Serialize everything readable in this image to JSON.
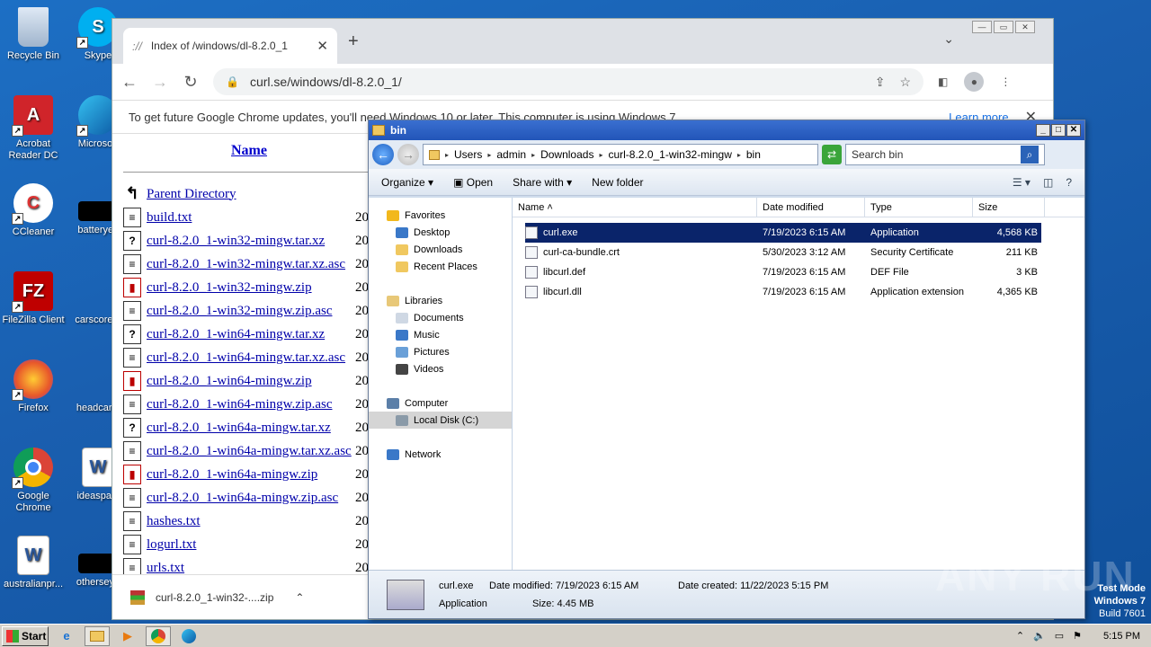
{
  "desktop": {
    "icons_col1": [
      "Recycle Bin",
      "Acrobat Reader DC",
      "CCleaner",
      "FileZilla Client",
      "Firefox",
      "Google Chrome",
      "australianpr..."
    ],
    "icons_col2": [
      "Skype",
      "Microsoft",
      "batteryey",
      "carscore...",
      "headcar...",
      "ideaspain",
      "otherseyo"
    ]
  },
  "chrome": {
    "tab_title": "Index of /windows/dl-8.2.0_1",
    "url": "curl.se/windows/dl-8.2.0_1/",
    "infobar_text": "To get future Google Chrome updates, you'll need Windows 10 or later. This computer is using Windows 7.",
    "infobar_link": "Learn more",
    "column_name": "Name",
    "files": [
      {
        "name": "Parent Directory",
        "icon": "back"
      },
      {
        "name": "build.txt",
        "icon": "text"
      },
      {
        "name": "curl-8.2.0_1-win32-mingw.tar.xz",
        "icon": "unknown"
      },
      {
        "name": "curl-8.2.0_1-win32-mingw.tar.xz.asc",
        "icon": "text"
      },
      {
        "name": "curl-8.2.0_1-win32-mingw.zip",
        "icon": "zip"
      },
      {
        "name": "curl-8.2.0_1-win32-mingw.zip.asc",
        "icon": "text"
      },
      {
        "name": "curl-8.2.0_1-win64-mingw.tar.xz",
        "icon": "unknown"
      },
      {
        "name": "curl-8.2.0_1-win64-mingw.tar.xz.asc",
        "icon": "text"
      },
      {
        "name": "curl-8.2.0_1-win64-mingw.zip",
        "icon": "zip"
      },
      {
        "name": "curl-8.2.0_1-win64-mingw.zip.asc",
        "icon": "text"
      },
      {
        "name": "curl-8.2.0_1-win64a-mingw.tar.xz",
        "icon": "unknown"
      },
      {
        "name": "curl-8.2.0_1-win64a-mingw.tar.xz.asc",
        "icon": "text"
      },
      {
        "name": "curl-8.2.0_1-win64a-mingw.zip",
        "icon": "zip"
      },
      {
        "name": "curl-8.2.0_1-win64a-mingw.zip.asc",
        "icon": "text"
      },
      {
        "name": "hashes.txt",
        "icon": "text"
      },
      {
        "name": "logurl.txt",
        "icon": "text"
      },
      {
        "name": "urls.txt",
        "icon": "text"
      }
    ],
    "date_prefix": "20",
    "download_item": "curl-8.2.0_1-win32-....zip"
  },
  "explorer": {
    "title": "bin",
    "breadcrumb": [
      "Users",
      "admin",
      "Downloads",
      "curl-8.2.0_1-win32-mingw",
      "bin"
    ],
    "search_placeholder": "Search bin",
    "toolbar": {
      "organize": "Organize",
      "open": "Open",
      "share_with": "Share with",
      "new_folder": "New folder"
    },
    "nav": {
      "favorites": "Favorites",
      "desktop": "Desktop",
      "downloads": "Downloads",
      "recent": "Recent Places",
      "libraries": "Libraries",
      "documents": "Documents",
      "music": "Music",
      "pictures": "Pictures",
      "videos": "Videos",
      "computer": "Computer",
      "local_disk": "Local Disk (C:)",
      "network": "Network"
    },
    "columns": {
      "name": "Name",
      "date": "Date modified",
      "type": "Type",
      "size": "Size"
    },
    "files": [
      {
        "name": "curl.exe",
        "date": "7/19/2023 6:15 AM",
        "type": "Application",
        "size": "4,568 KB"
      },
      {
        "name": "curl-ca-bundle.crt",
        "date": "5/30/2023 3:12 AM",
        "type": "Security Certificate",
        "size": "211 KB"
      },
      {
        "name": "libcurl.def",
        "date": "7/19/2023 6:15 AM",
        "type": "DEF File",
        "size": "3 KB"
      },
      {
        "name": "libcurl.dll",
        "date": "7/19/2023 6:15 AM",
        "type": "Application extension",
        "size": "4,365 KB"
      }
    ],
    "status": {
      "filename": "curl.exe",
      "modified": "Date modified: 7/19/2023 6:15 AM",
      "created": "Date created: 11/22/2023 5:15 PM",
      "type": "Application",
      "size": "Size: 4.45 MB"
    }
  },
  "taskbar": {
    "start": "Start",
    "clock": "5:15 PM"
  },
  "overlay": {
    "watermark": "ANY RUN",
    "test_mode": "Test Mode",
    "os": "Windows 7",
    "build": "Build 7601"
  }
}
